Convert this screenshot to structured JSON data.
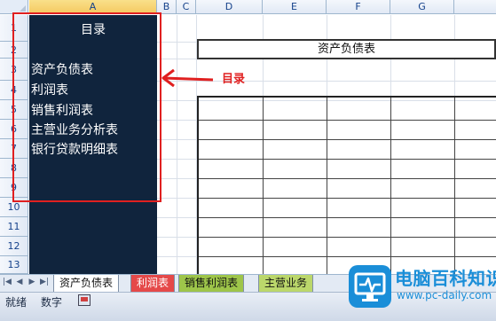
{
  "columns": [
    "A",
    "B",
    "C",
    "D",
    "E",
    "F",
    "G"
  ],
  "rows": [
    "1",
    "2",
    "3",
    "4",
    "5",
    "6",
    "7",
    "8",
    "9",
    "10",
    "11",
    "12",
    "13"
  ],
  "toc": {
    "title": "目录",
    "items": [
      "资产负债表",
      "利润表",
      "销售利润表",
      "主营业务分析表",
      "银行贷款明细表"
    ]
  },
  "annotation": {
    "label": "目录"
  },
  "balance_sheet_title": "资产负债表",
  "tabs": [
    {
      "label": "资产负债表",
      "state": "active"
    },
    {
      "label": "利润表",
      "color": "#e54949"
    },
    {
      "label": "销售利润表",
      "color": "#9ec54a"
    },
    {
      "label": "主营业务",
      "color": "#bbd76b"
    }
  ],
  "status": {
    "ready": "就绪",
    "num": "数字"
  },
  "watermark": {
    "name": "电脑百科知识",
    "url": "www.pc-daily.com"
  },
  "colors": {
    "toc_panel": "#10243d",
    "highlight": "#e02020",
    "watermark": "#1a8ed8"
  }
}
